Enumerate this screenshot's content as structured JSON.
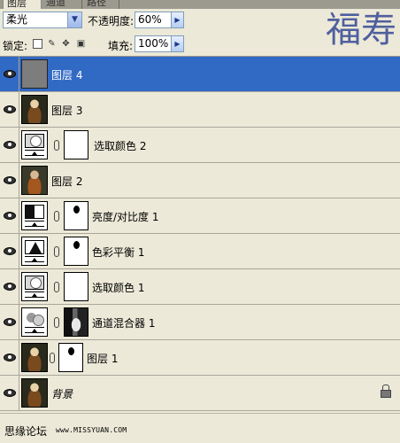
{
  "tabs": [
    {
      "label": "图层",
      "active": true
    },
    {
      "label": "通道",
      "active": false
    },
    {
      "label": "路径",
      "active": false
    }
  ],
  "options": {
    "blend_mode": "柔光",
    "opacity_label": "不透明度:",
    "opacity_value": "60%"
  },
  "watermark": "福寿",
  "lock": {
    "label": "锁定:",
    "fill_label": "填充:",
    "fill_value": "100%",
    "icons": [
      "lock-transparency-icon",
      "lock-brush-icon",
      "lock-move-icon",
      "lock-all-icon"
    ]
  },
  "layers": [
    {
      "name": "图层 4",
      "selected": true,
      "thumb": "gray",
      "mask": null
    },
    {
      "name": "图层 3",
      "selected": false,
      "thumb": "photo",
      "mask": null
    },
    {
      "name": "选取颜色 2",
      "selected": false,
      "thumb": "selective-color",
      "mask": "white"
    },
    {
      "name": "图层 2",
      "selected": false,
      "thumb": "photo-alt",
      "mask": null
    },
    {
      "name": "亮度/对比度 1",
      "selected": false,
      "thumb": "brightness-contrast",
      "mask": "figure"
    },
    {
      "name": "色彩平衡 1",
      "selected": false,
      "thumb": "color-balance",
      "mask": "figure"
    },
    {
      "name": "选取颜色 1",
      "selected": false,
      "thumb": "selective-color",
      "mask": "white"
    },
    {
      "name": "通道混合器 1",
      "selected": false,
      "thumb": "channel-mixer",
      "mask": "dark"
    },
    {
      "name": "图层 1",
      "selected": false,
      "thumb": "photo",
      "mask": "figure"
    },
    {
      "name": "背景",
      "selected": false,
      "thumb": "photo",
      "mask": null,
      "locked": true
    }
  ],
  "footer": {
    "brand": "思缘论坛",
    "url": "www.MISSYUAN.COM"
  }
}
